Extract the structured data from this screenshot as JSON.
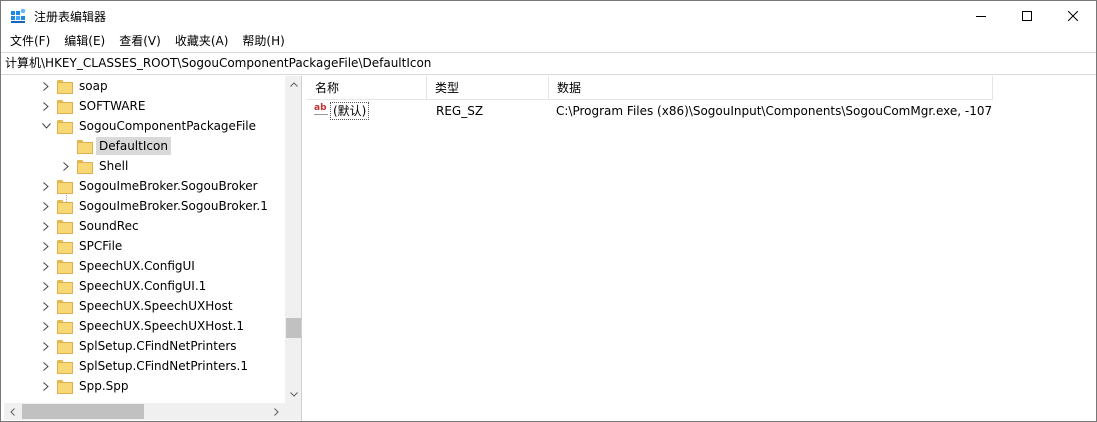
{
  "window": {
    "title": "注册表编辑器",
    "icon": "regedit-icon"
  },
  "menu": {
    "items": [
      "文件(F)",
      "编辑(E)",
      "查看(V)",
      "收藏夹(A)",
      "帮助(H)"
    ]
  },
  "address": {
    "path": "计算机\\HKEY_CLASSES_ROOT\\SogouComponentPackageFile\\DefaultIcon"
  },
  "tree": {
    "items": [
      {
        "label": "soap",
        "expanded": false,
        "level": 1
      },
      {
        "label": "SOFTWARE",
        "expanded": false,
        "level": 1
      },
      {
        "label": "SogouComponentPackageFile",
        "expanded": true,
        "level": 1
      },
      {
        "label": "DefaultIcon",
        "expanded": null,
        "level": 2,
        "selected": true
      },
      {
        "label": "Shell",
        "expanded": false,
        "level": 2
      },
      {
        "label": "SogouImeBroker.SogouBroker",
        "expanded": false,
        "level": 1
      },
      {
        "label": "SogouImeBroker.SogouBroker.1",
        "expanded": false,
        "level": 1
      },
      {
        "label": "SoundRec",
        "expanded": false,
        "level": 1
      },
      {
        "label": "SPCFile",
        "expanded": false,
        "level": 1
      },
      {
        "label": "SpeechUX.ConfigUI",
        "expanded": false,
        "level": 1
      },
      {
        "label": "SpeechUX.ConfigUI.1",
        "expanded": false,
        "level": 1
      },
      {
        "label": "SpeechUX.SpeechUXHost",
        "expanded": false,
        "level": 1
      },
      {
        "label": "SpeechUX.SpeechUXHost.1",
        "expanded": false,
        "level": 1
      },
      {
        "label": "SplSetup.CFindNetPrinters",
        "expanded": false,
        "level": 1
      },
      {
        "label": "SplSetup.CFindNetPrinters.1",
        "expanded": false,
        "level": 1
      },
      {
        "label": "Spp.Spp",
        "expanded": false,
        "level": 1
      }
    ]
  },
  "list": {
    "columns": [
      "名称",
      "类型",
      "数据"
    ],
    "rows": [
      {
        "name": "(默认)",
        "type": "REG_SZ",
        "data": "C:\\Program Files (x86)\\SogouInput\\Components\\SogouComMgr.exe, -107",
        "icon": "string-value-icon"
      }
    ]
  }
}
